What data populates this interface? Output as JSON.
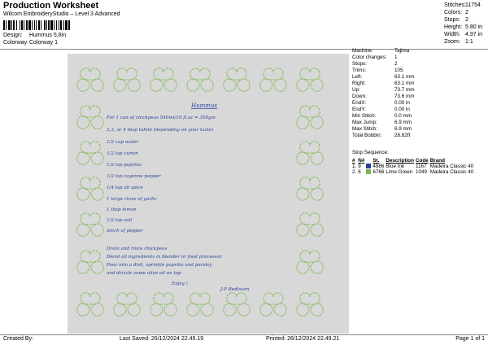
{
  "header": {
    "title": "Production Worksheet",
    "subtitle": "Wilcom EmbroideryStudio – Level 3 Advanced",
    "design_label": "Design:",
    "design_value": "Hummus 5,8in",
    "colorway_label": "Colorway:",
    "colorway_value": "Colorway 1"
  },
  "summary": [
    {
      "label": "Stitches:",
      "value": "11754"
    },
    {
      "label": "Colors:",
      "value": "2"
    },
    {
      "label": "Stops:",
      "value": "2"
    },
    {
      "label": "Height:",
      "value": "5.80 in"
    },
    {
      "label": "Width:",
      "value": "4.97 in"
    },
    {
      "label": "Zoom:",
      "value": "1:1"
    }
  ],
  "properties": [
    {
      "label": "Machine:",
      "value": "Tajima"
    },
    {
      "label": "Color changes:",
      "value": "1"
    },
    {
      "label": "Stops:",
      "value": "2"
    },
    {
      "label": "Trims:",
      "value": "105"
    },
    {
      "label": "Left:",
      "value": "63.1 mm"
    },
    {
      "label": "Right:",
      "value": "63.1 mm"
    },
    {
      "label": "Up:",
      "value": "73.7 mm"
    },
    {
      "label": "Down:",
      "value": "73.6 mm"
    },
    {
      "label": "EndX:",
      "value": "0.00 in"
    },
    {
      "label": "EndY:",
      "value": "0.00 in"
    },
    {
      "label": "Min Stitch:",
      "value": "0.0 mm"
    },
    {
      "label": "Max Jump:",
      "value": "6.9 mm"
    },
    {
      "label": "Max Stitch:",
      "value": "6.9 mm"
    },
    {
      "label": "Total Bobbin:",
      "value": "28.82ft"
    }
  ],
  "stop_sequence": {
    "title": "Stop Sequence:",
    "columns": [
      "#",
      "N#",
      "",
      "St.",
      "Description",
      "Code",
      "Brand"
    ],
    "rows": [
      {
        "num": "1.",
        "n": "9",
        "color": "#2a3f9a",
        "st": "4986",
        "description": "Blue Ink",
        "code": "1167",
        "brand": "Madeira Classic 40"
      },
      {
        "num": "2.",
        "n": "6",
        "color": "#7ab84a",
        "st": "6766",
        "description": "Lime Green",
        "code": "1049",
        "brand": "Madeira Classic 40"
      }
    ]
  },
  "recipe": {
    "title": "Hummus",
    "lines": [
      "For 1 can of chickpeas 540ml/19 fl.oz = 350gm",
      "2,3, or 4 tbsp tahini (depending on your taste)",
      "1/2 cup water",
      "1/2 tsp cumin",
      "1/2 tsp paprika",
      "1/2 tsp cayenne pepper",
      "1/4 tsp all spice",
      "1 large clove of garlic",
      "1 tbsp lemon",
      "1/2 tsp salt",
      "pinch of pepper"
    ],
    "method": [
      "Drain and rince chickpeas",
      "Blend all ingredients in blender or food processor",
      "Pour into a dish, sprinkle paprika and parsley",
      "and drizzle some olive oil on top"
    ],
    "enjoy": "Enjoy !",
    "signature": "J-P Bedisson"
  },
  "footer": {
    "created_by": "Created By:",
    "last_saved": "Last Saved: 26/12/2024 22.49.19",
    "printed": "Printed: 26/12/2024 22.49.21",
    "page": "Page 1 of 1"
  }
}
